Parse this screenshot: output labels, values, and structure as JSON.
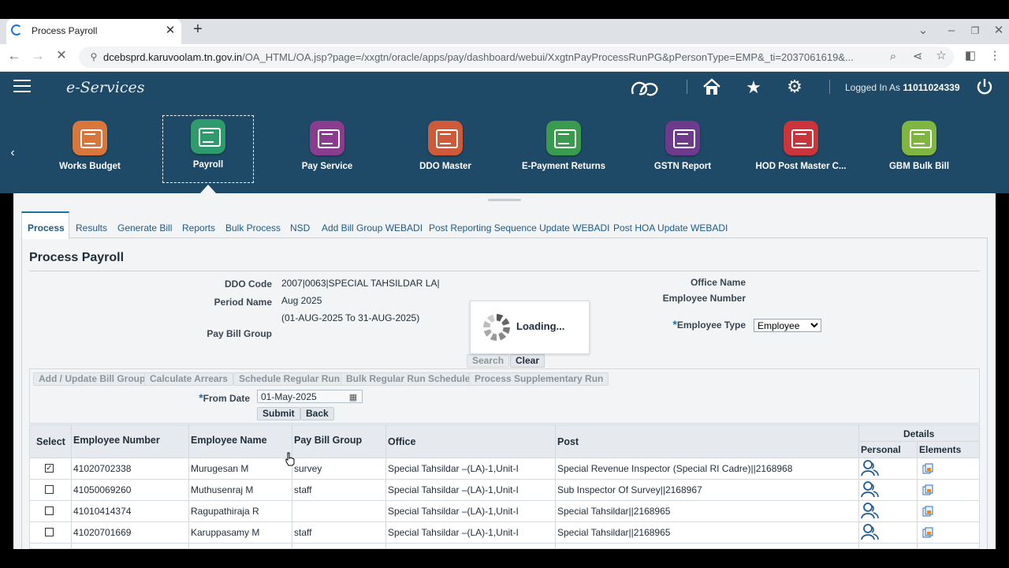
{
  "browser": {
    "tab_title": "Process Payroll",
    "url_host": "dcebsprd.karuvoolam.tn.gov.in",
    "url_path": "/OA_HTML/OA.jsp?page=/xxgtn/oracle/apps/pay/dashboard/webui/XxgtnPayProcessRunPG&pPersonType=EMP&_ti=2037061619&..."
  },
  "header": {
    "brand": "e-Services",
    "logged_in_label": "Logged In As",
    "user_id": "11011024339"
  },
  "launcher": [
    {
      "label": "Works Budget",
      "color": "#d9763c"
    },
    {
      "label": "Payroll",
      "color": "#2f9a6b"
    },
    {
      "label": "Pay Service",
      "color": "#8a3c8f"
    },
    {
      "label": "DDO Master",
      "color": "#cf5a3a"
    },
    {
      "label": "E-Payment Returns",
      "color": "#3a9a4e"
    },
    {
      "label": "GSTN Report",
      "color": "#6e3a8c"
    },
    {
      "label": "HOD Post Master C...",
      "color": "#c9353a"
    },
    {
      "label": "GBM Bulk Bill",
      "color": "#7fb640"
    }
  ],
  "subtabs": [
    "Process",
    "Results",
    "Generate Bill",
    "Reports",
    "Bulk Process",
    "NSD",
    "Add Bill Group WEBADI",
    "Post Reporting Sequence Update WEBADI",
    "Post HOA Update WEBADI"
  ],
  "page_title": "Process Payroll",
  "form": {
    "ddo_code_label": "DDO Code",
    "ddo_code": "2007|0063|SPECIAL TAHSILDAR LA|",
    "period_name_label": "Period Name",
    "period_name": "Aug 2025",
    "period_range": "(01-AUG-2025 To 31-AUG-2025)",
    "pay_bill_group_label": "Pay Bill Group",
    "office_name_label": "Office Name",
    "employee_number_label": "Employee Number",
    "employee_type_label": "Employee Type",
    "employee_type": "Employee",
    "search_label": "Search",
    "clear_label": "Clear",
    "loading": "Loading..."
  },
  "actions": {
    "add_update": "Add / Update Bill Group",
    "calc_arrears": "Calculate Arrears",
    "schedule_regular": "Schedule Regular Run",
    "bulk_regular": "Bulk Regular Run Schedule",
    "process_supp": "Process Supplementary Run",
    "from_date_label": "From Date",
    "from_date": "01-May-2025",
    "submit": "Submit",
    "back": "Back"
  },
  "table": {
    "headers": {
      "select": "Select",
      "employee_number": "Employee Number",
      "employee_name": "Employee Name",
      "pay_bill_group": "Pay Bill Group",
      "office": "Office",
      "post": "Post",
      "details": "Details",
      "personal": "Personal",
      "elements": "Elements"
    },
    "rows": [
      {
        "checked": true,
        "emp_no": "41020702338",
        "name": "Murugesan M",
        "group": "survey",
        "office": "Special Tahsildar –(LA)-1,Unit-I",
        "post": "Special Revenue Inspector (Special RI Cadre)||2168968"
      },
      {
        "checked": false,
        "emp_no": "41050069260",
        "name": "Muthusenraj M",
        "group": "staff",
        "office": "Special Tahsildar –(LA)-1,Unit-I",
        "post": "Sub Inspector Of Survey||2168967"
      },
      {
        "checked": false,
        "emp_no": "41010414374",
        "name": "Ragupathiraja R",
        "group": "",
        "office": "Special Tahsildar –(LA)-1,Unit-I",
        "post": "Special Tahsildar||2168965"
      },
      {
        "checked": false,
        "emp_no": "41020701669",
        "name": "Karuppasamy M",
        "group": "staff",
        "office": "Special Tahsildar –(LA)-1,Unit-I",
        "post": "Special Tahsildar||2168965"
      }
    ]
  }
}
